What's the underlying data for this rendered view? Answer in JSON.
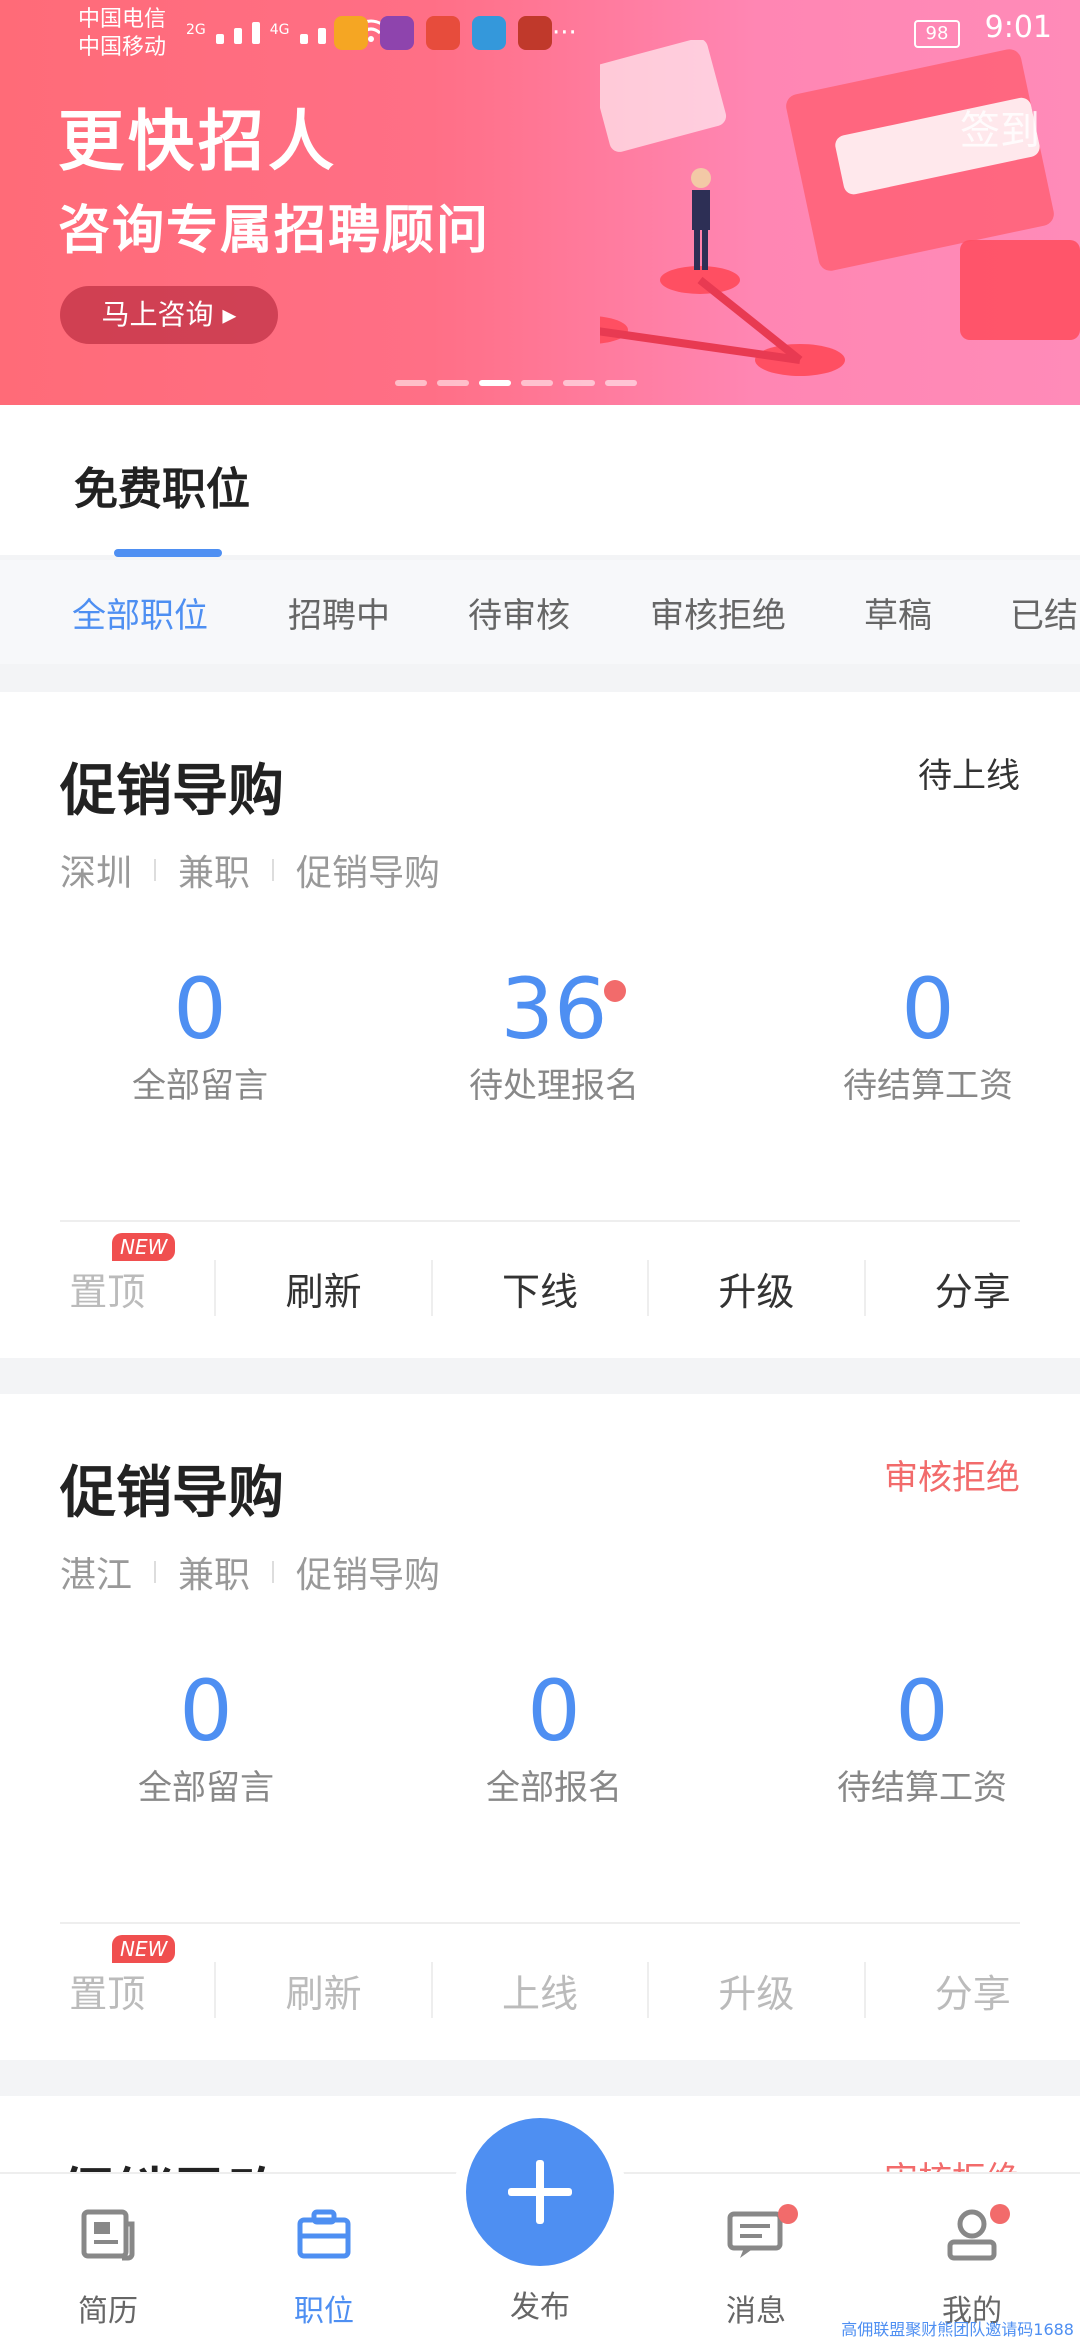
{
  "status_bar": {
    "carrier_1": "中国电信",
    "carrier_2": "中国移动",
    "net_1": "2G",
    "net_2": "4G",
    "battery": "98",
    "time": "9:01",
    "more": "···"
  },
  "banner": {
    "title": "更快招人",
    "subtitle": "咨询专属招聘顾问",
    "consult_button": "马上咨询",
    "sign_in": "签到",
    "pager_count": 6,
    "pager_active": 2
  },
  "section": {
    "title": "免费职位"
  },
  "tabs": [
    {
      "label": "全部职位",
      "active": true
    },
    {
      "label": "招聘中",
      "active": false
    },
    {
      "label": "待审核",
      "active": false
    },
    {
      "label": "审核拒绝",
      "active": false
    },
    {
      "label": "草稿",
      "active": false
    },
    {
      "label": "已结",
      "active": false
    }
  ],
  "jobs": [
    {
      "title": "促销导购",
      "status": "待上线",
      "status_color": "#333333",
      "city": "深圳",
      "type": "兼职",
      "category": "促销导购",
      "stats": [
        {
          "value": "0",
          "label": "全部留言"
        },
        {
          "value": "36",
          "label": "待处理报名"
        },
        {
          "value": "0",
          "label": "待结算工资"
        }
      ],
      "actions": [
        "置顶",
        "刷新",
        "下线",
        "升级",
        "分享"
      ],
      "new_badge": "NEW"
    },
    {
      "title": "促销导购",
      "status": "审核拒绝",
      "status_color": "#f26b6b",
      "city": "湛江",
      "type": "兼职",
      "category": "促销导购",
      "stats": [
        {
          "value": "0",
          "label": "全部留言"
        },
        {
          "value": "0",
          "label": "全部报名"
        },
        {
          "value": "0",
          "label": "待结算工资"
        }
      ],
      "actions": [
        "置顶",
        "刷新",
        "上线",
        "升级",
        "分享"
      ],
      "new_badge": "NEW"
    },
    {
      "title": "促销导购",
      "status": "审核拒绝"
    }
  ],
  "bottom_nav": [
    {
      "label": "简历",
      "icon": "resume-icon",
      "active": false
    },
    {
      "label": "职位",
      "icon": "briefcase-icon",
      "active": true
    },
    {
      "label": "发布",
      "icon": "plus-icon",
      "active": false
    },
    {
      "label": "消息",
      "icon": "message-icon",
      "active": false
    },
    {
      "label": "我的",
      "icon": "profile-icon",
      "active": false
    }
  ],
  "watermark": "高佣联盟聚财熊团队邀请码1688",
  "colors": {
    "accent": "#4e8ff2",
    "alert": "#f26b6b"
  }
}
